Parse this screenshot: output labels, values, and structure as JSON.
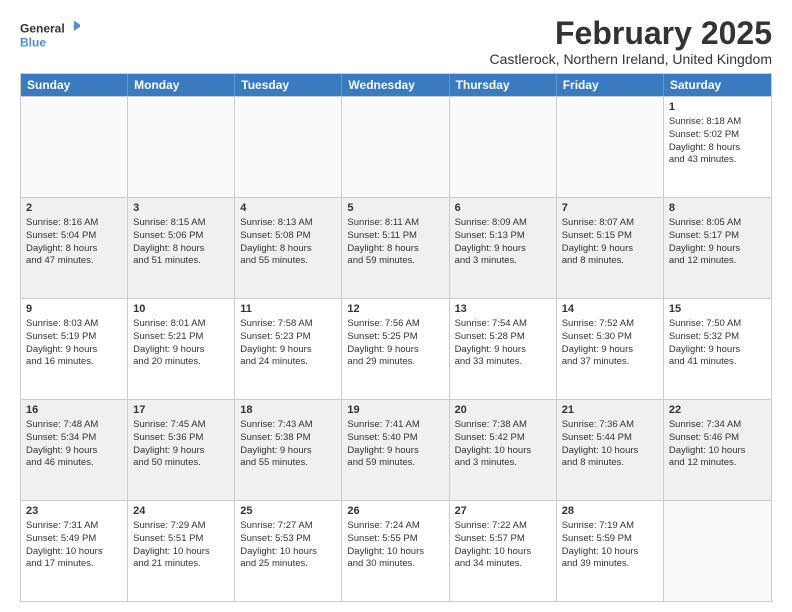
{
  "logo": {
    "line1": "General",
    "line2": "Blue"
  },
  "title": "February 2025",
  "subtitle": "Castlerock, Northern Ireland, United Kingdom",
  "weekdays": [
    "Sunday",
    "Monday",
    "Tuesday",
    "Wednesday",
    "Thursday",
    "Friday",
    "Saturday"
  ],
  "rows": [
    [
      {
        "day": "",
        "text": ""
      },
      {
        "day": "",
        "text": ""
      },
      {
        "day": "",
        "text": ""
      },
      {
        "day": "",
        "text": ""
      },
      {
        "day": "",
        "text": ""
      },
      {
        "day": "",
        "text": ""
      },
      {
        "day": "1",
        "text": "Sunrise: 8:18 AM\nSunset: 5:02 PM\nDaylight: 8 hours\nand 43 minutes."
      }
    ],
    [
      {
        "day": "2",
        "text": "Sunrise: 8:16 AM\nSunset: 5:04 PM\nDaylight: 8 hours\nand 47 minutes."
      },
      {
        "day": "3",
        "text": "Sunrise: 8:15 AM\nSunset: 5:06 PM\nDaylight: 8 hours\nand 51 minutes."
      },
      {
        "day": "4",
        "text": "Sunrise: 8:13 AM\nSunset: 5:08 PM\nDaylight: 8 hours\nand 55 minutes."
      },
      {
        "day": "5",
        "text": "Sunrise: 8:11 AM\nSunset: 5:11 PM\nDaylight: 8 hours\nand 59 minutes."
      },
      {
        "day": "6",
        "text": "Sunrise: 8:09 AM\nSunset: 5:13 PM\nDaylight: 9 hours\nand 3 minutes."
      },
      {
        "day": "7",
        "text": "Sunrise: 8:07 AM\nSunset: 5:15 PM\nDaylight: 9 hours\nand 8 minutes."
      },
      {
        "day": "8",
        "text": "Sunrise: 8:05 AM\nSunset: 5:17 PM\nDaylight: 9 hours\nand 12 minutes."
      }
    ],
    [
      {
        "day": "9",
        "text": "Sunrise: 8:03 AM\nSunset: 5:19 PM\nDaylight: 9 hours\nand 16 minutes."
      },
      {
        "day": "10",
        "text": "Sunrise: 8:01 AM\nSunset: 5:21 PM\nDaylight: 9 hours\nand 20 minutes."
      },
      {
        "day": "11",
        "text": "Sunrise: 7:58 AM\nSunset: 5:23 PM\nDaylight: 9 hours\nand 24 minutes."
      },
      {
        "day": "12",
        "text": "Sunrise: 7:56 AM\nSunset: 5:25 PM\nDaylight: 9 hours\nand 29 minutes."
      },
      {
        "day": "13",
        "text": "Sunrise: 7:54 AM\nSunset: 5:28 PM\nDaylight: 9 hours\nand 33 minutes."
      },
      {
        "day": "14",
        "text": "Sunrise: 7:52 AM\nSunset: 5:30 PM\nDaylight: 9 hours\nand 37 minutes."
      },
      {
        "day": "15",
        "text": "Sunrise: 7:50 AM\nSunset: 5:32 PM\nDaylight: 9 hours\nand 41 minutes."
      }
    ],
    [
      {
        "day": "16",
        "text": "Sunrise: 7:48 AM\nSunset: 5:34 PM\nDaylight: 9 hours\nand 46 minutes."
      },
      {
        "day": "17",
        "text": "Sunrise: 7:45 AM\nSunset: 5:36 PM\nDaylight: 9 hours\nand 50 minutes."
      },
      {
        "day": "18",
        "text": "Sunrise: 7:43 AM\nSunset: 5:38 PM\nDaylight: 9 hours\nand 55 minutes."
      },
      {
        "day": "19",
        "text": "Sunrise: 7:41 AM\nSunset: 5:40 PM\nDaylight: 9 hours\nand 59 minutes."
      },
      {
        "day": "20",
        "text": "Sunrise: 7:38 AM\nSunset: 5:42 PM\nDaylight: 10 hours\nand 3 minutes."
      },
      {
        "day": "21",
        "text": "Sunrise: 7:36 AM\nSunset: 5:44 PM\nDaylight: 10 hours\nand 8 minutes."
      },
      {
        "day": "22",
        "text": "Sunrise: 7:34 AM\nSunset: 5:46 PM\nDaylight: 10 hours\nand 12 minutes."
      }
    ],
    [
      {
        "day": "23",
        "text": "Sunrise: 7:31 AM\nSunset: 5:49 PM\nDaylight: 10 hours\nand 17 minutes."
      },
      {
        "day": "24",
        "text": "Sunrise: 7:29 AM\nSunset: 5:51 PM\nDaylight: 10 hours\nand 21 minutes."
      },
      {
        "day": "25",
        "text": "Sunrise: 7:27 AM\nSunset: 5:53 PM\nDaylight: 10 hours\nand 25 minutes."
      },
      {
        "day": "26",
        "text": "Sunrise: 7:24 AM\nSunset: 5:55 PM\nDaylight: 10 hours\nand 30 minutes."
      },
      {
        "day": "27",
        "text": "Sunrise: 7:22 AM\nSunset: 5:57 PM\nDaylight: 10 hours\nand 34 minutes."
      },
      {
        "day": "28",
        "text": "Sunrise: 7:19 AM\nSunset: 5:59 PM\nDaylight: 10 hours\nand 39 minutes."
      },
      {
        "day": "",
        "text": ""
      }
    ]
  ]
}
